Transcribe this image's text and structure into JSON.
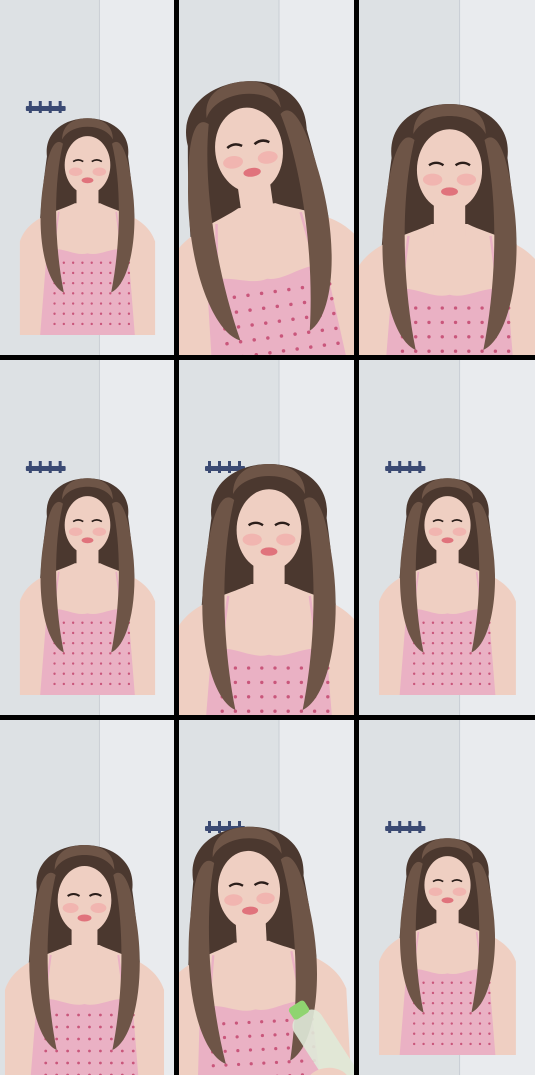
{
  "grid": {
    "rows": 3,
    "columns": 3
  },
  "palette": {
    "wall": "#e9ebee",
    "wall_shadow": "#d4d8dd",
    "hair": "#6e5547",
    "hair_dark": "#4b382f",
    "skin": "#efcfc2",
    "blush": "#f2a3a3",
    "lips": "#e0737c",
    "top": "#eab1c4",
    "top_dots": "#c9567b",
    "bottle": "#dfe9d8",
    "bottle_cap": "#8fd470"
  },
  "frames": [
    {
      "pose": "centered-far",
      "rack": true
    },
    {
      "pose": "leaning-close",
      "rack": false
    },
    {
      "pose": "close-up",
      "rack": false
    },
    {
      "pose": "centered-far",
      "rack": true
    },
    {
      "pose": "close-up",
      "rack": true
    },
    {
      "pose": "centered-far",
      "rack": true
    },
    {
      "pose": "centered-mid",
      "rack": false
    },
    {
      "pose": "holding-bottle",
      "rack": true
    },
    {
      "pose": "centered-far",
      "rack": true
    }
  ]
}
